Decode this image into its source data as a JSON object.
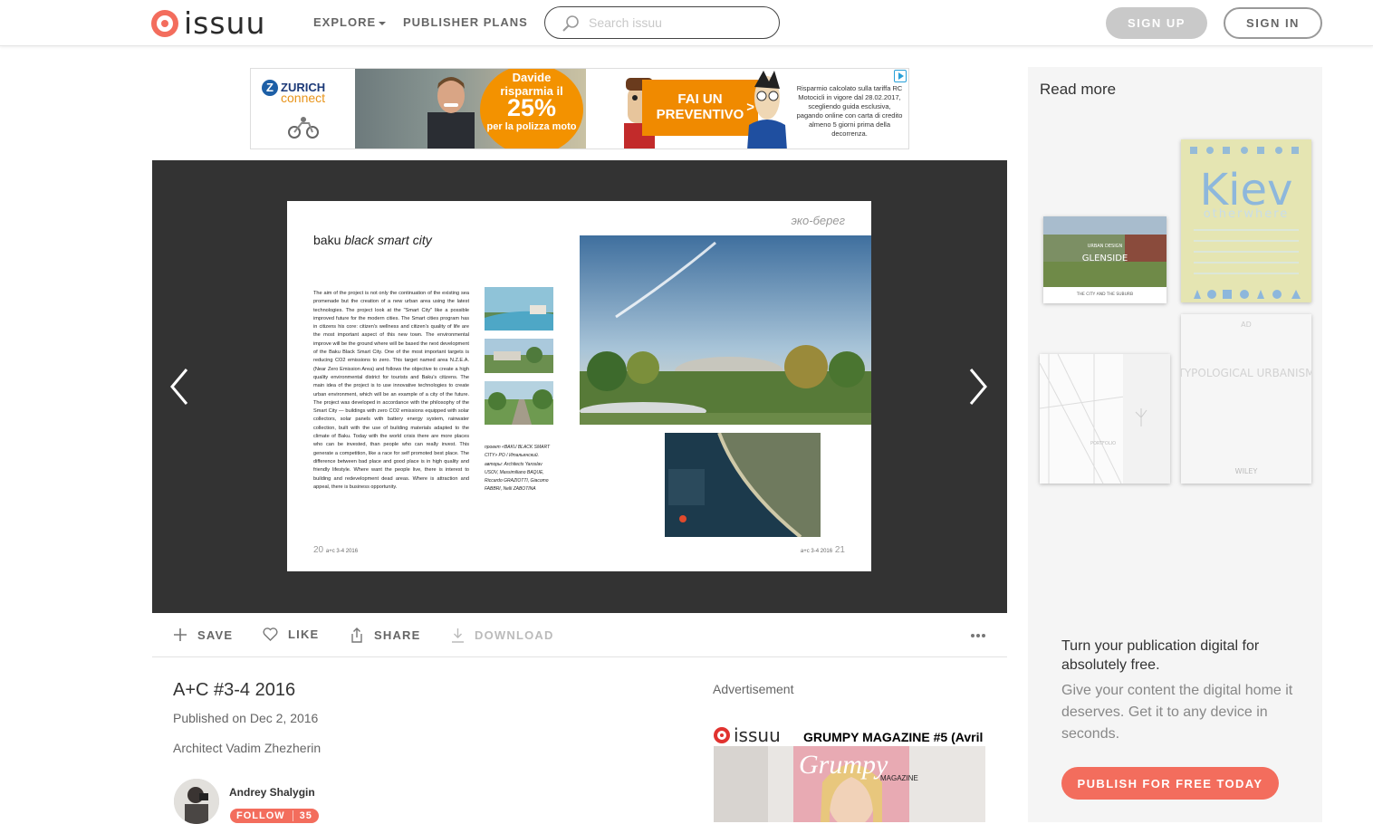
{
  "header": {
    "logo_text": "issuu",
    "nav_explore": "EXPLORE",
    "nav_publisher_plans": "PUBLISHER PLANS",
    "search_placeholder": "Search issuu",
    "signup_label": "SIGN UP",
    "signin_label": "SIGN IN"
  },
  "ad_banner": {
    "brand_line1": "ZURICH",
    "brand_line2": "connect",
    "circle_line1": "Davide",
    "circle_line2": "risparmia il",
    "circle_percent": "25%",
    "circle_line4": "per la polizza moto",
    "cta": "FAI UN PREVENTIVO",
    "cta_arrow": ">",
    "fine_print": "Risparmio calcolato sulla tariffa RC Motocicli in vigore dal 28.02.2017, scegliendo guida esclusiva, pagando online con carta di credito almeno 5 giorni prima della decorrenza."
  },
  "spread": {
    "title_plain": "baku",
    "title_italic": "black smart city",
    "header_right": "эко-берег",
    "body_text": "The aim of the project is not only the continuation of the existing sea promenade but the creation of a new urban area using the latest technologies. The project look at the \"Smart City\" like a possible improved future for the modern cities. The Smart cities program has in citizens his core: citizen's wellness and citizen's quality of life are the most important aspect of this new town. The environmental improve will be the ground where will be based the next development of the Baku Black Smart City. One of the most important targets is reducing CO2 emissions to zero. This target named area N.Z.E.A. (Near Zero Emission Area) and follows the objective to create a high quality environmental district for tourists and Baku's citizens. The main idea of the project is to use innovative technologies to create urban environment, which will be an example of a city of the future. The project was developed in accordance with the philosophy of the Smart City — buildings with zero CO2 emissions equipped with solar collectors, solar panels with battery energy system, rainwater collection, built with the use of building materials adapted to the climate of Baku. Today with the world crisis there are more places who can be invested, than people who can really invest. This generate a competition, like a race for self promoted best place. The difference between bad place and good place is in high quality and friendly lifestyle. Where want the people live, there is interest to building and redevelopment dead areas. Where is attraction and appeal, there is business opportunity.",
    "credits": "проект «BAKU BLACK SMART CITY» PO / Итальянский. авторы: Architects Yaroslav USOV, Massimiliano BAQUE, Riccardo GRAZIOTTI, Giacomo FABBRI, Nelli ZABOTINA",
    "folio_left_num": "20",
    "folio_left_mag": "a+c 3-4 2016",
    "folio_right_mag": "a+c 3-4 2016",
    "folio_right_num": "21"
  },
  "actions": {
    "save": "SAVE",
    "like": "LIKE",
    "share": "SHARE",
    "download": "DOWNLOAD"
  },
  "publication": {
    "title": "A+C #3-4 2016",
    "published": "Published on Dec 2, 2016",
    "description": "Architect Vadim Zhezherin",
    "author": "Andrey Shalygin",
    "follow_label": "FOLLOW",
    "follow_count": "35"
  },
  "advertisement": {
    "label": "Advertisement",
    "logo_text": "issuu",
    "title": "GRUMPY MAGAZINE #5 (Avril",
    "cover_title": "Grumpy",
    "cover_sub": "MAGAZINE"
  },
  "sidebar": {
    "read_more": "Read more",
    "cover1_title": "GLENSIDE",
    "cover1_top": "URBAN DESIGN",
    "cover1_sub": "THE CITY AND THE SUBURB",
    "cover2_title": "Kiev",
    "cover2_sub": "otherwhere",
    "cover3_label": "PORTFOLIO",
    "cover4_title": "TYPOLOGICAL URBANISM",
    "cover4_publisher": "WILEY",
    "promo_headline": "Turn your publication digital for absolutely free.",
    "promo_body": "Give your content the digital home it deserves. Get it to any device in seconds.",
    "publish_button": "PUBLISH FOR FREE TODAY"
  },
  "colors": {
    "brand": "#f36d5d",
    "viewer_bg": "#333333",
    "sidebar_bg": "#f5f5f5"
  },
  "icons": [
    "issuu-logo-icon",
    "search-icon",
    "chevron-left-icon",
    "chevron-right-icon",
    "plus-icon",
    "heart-icon",
    "share-icon",
    "download-icon",
    "more-dots-icon",
    "adchoices-icon"
  ]
}
